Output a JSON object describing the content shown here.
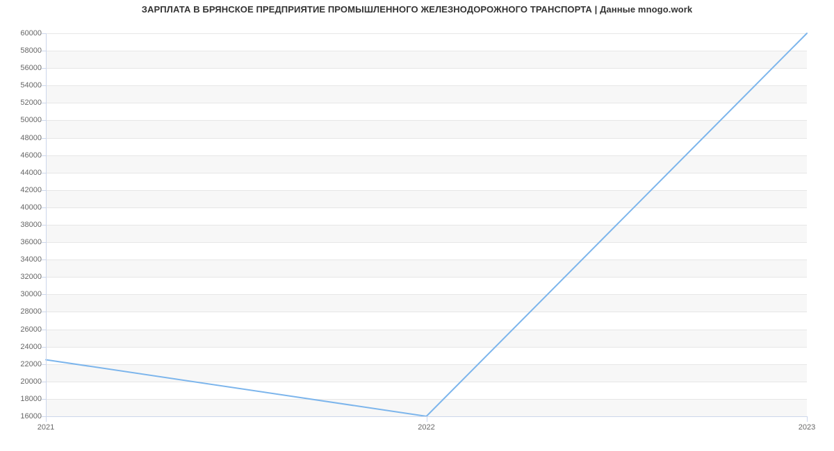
{
  "chart_data": {
    "type": "line",
    "title": "ЗАРПЛАТА В БРЯНСКОЕ ПРЕДПРИЯТИЕ ПРОМЫШЛЕННОГО ЖЕЛЕЗНОДОРОЖНОГО ТРАНСПОРТА  | Данные mnogo.work",
    "xlabel": "",
    "ylabel": "",
    "categories": [
      "2021",
      "2022",
      "2023"
    ],
    "x": [
      2021,
      2022,
      2023
    ],
    "values": [
      22500,
      16000,
      60000
    ],
    "y_ticks": [
      16000,
      18000,
      20000,
      22000,
      24000,
      26000,
      28000,
      30000,
      32000,
      34000,
      36000,
      38000,
      40000,
      42000,
      44000,
      46000,
      48000,
      50000,
      52000,
      54000,
      56000,
      58000,
      60000
    ],
    "ylim": [
      16000,
      60000
    ],
    "xlim": [
      2021,
      2023
    ],
    "line_color": "#7cb5ec",
    "band_color": "#f7f7f7",
    "grid": true
  }
}
